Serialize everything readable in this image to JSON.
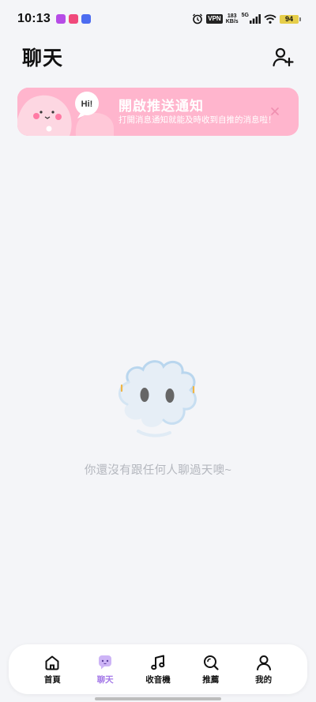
{
  "status_bar": {
    "time": "10:13",
    "vpn": "VPN",
    "speed_value": "183",
    "speed_unit": "KB/s",
    "network": "5G",
    "battery": "94"
  },
  "header": {
    "title": "聊天",
    "add_friend_icon": "person-add-icon"
  },
  "banner": {
    "title": "開啟推送通知",
    "subtitle": "打開消息通知就能及時收到自推的消息啦！",
    "art_text": "Hi!",
    "background": "#ffb5cd"
  },
  "empty_state": {
    "message": "你還沒有跟任何人聊過天噢~"
  },
  "bottom_nav": {
    "items": [
      {
        "label": "首頁",
        "icon": "home-icon"
      },
      {
        "label": "聊天",
        "icon": "chat-icon"
      },
      {
        "label": "收音機",
        "icon": "music-note-icon"
      },
      {
        "label": "推薦",
        "icon": "search-icon"
      },
      {
        "label": "我的",
        "icon": "user-icon"
      }
    ],
    "active_index": 1,
    "active_color": "#a479e8"
  }
}
